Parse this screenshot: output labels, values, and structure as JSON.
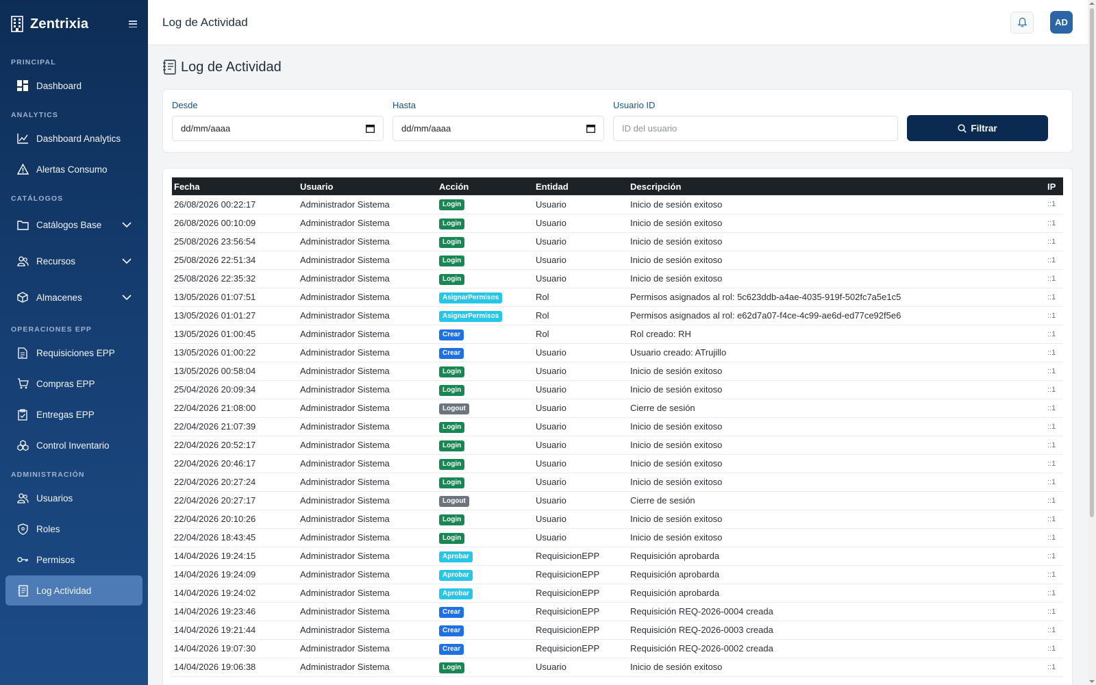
{
  "app": {
    "name": "Zentrixia"
  },
  "sidebar": {
    "sections": [
      {
        "title": "PRINCIPAL",
        "items": [
          {
            "label": "Dashboard",
            "icon": "dashboard-icon"
          }
        ]
      },
      {
        "title": "ANALYTICS",
        "items": [
          {
            "label": "Dashboard Analytics",
            "icon": "chart-line-icon"
          },
          {
            "label": "Alertas Consumo",
            "icon": "warning-icon"
          }
        ]
      },
      {
        "title": "CATÁLOGOS",
        "items": [
          {
            "label": "Catálogos Base",
            "icon": "folder-icon"
          },
          {
            "label": "Recursos",
            "icon": "people-icon"
          },
          {
            "label": "Almacenes",
            "icon": "box-icon"
          }
        ]
      },
      {
        "title": "OPERACIONES EPP",
        "items": [
          {
            "label": "Requisiciones EPP",
            "icon": "document-icon"
          },
          {
            "label": "Compras EPP",
            "icon": "cart-icon"
          },
          {
            "label": "Entregas EPP",
            "icon": "clipboard-check-icon"
          },
          {
            "label": "Control Inventario",
            "icon": "boxes-icon"
          }
        ]
      },
      {
        "title": "ADMINISTRACIÓN",
        "items": [
          {
            "label": "Usuarios",
            "icon": "people-icon"
          },
          {
            "label": "Roles",
            "icon": "shield-icon"
          },
          {
            "label": "Permisos",
            "icon": "key-icon"
          },
          {
            "label": "Log Actividad",
            "icon": "journal-icon"
          }
        ]
      }
    ]
  },
  "header": {
    "title": "Log de Actividad",
    "avatar_initials": "AD"
  },
  "page": {
    "title": "Log de Actividad"
  },
  "filters": {
    "desde_label": "Desde",
    "desde_value": "dd/mm/aaaa",
    "hasta_label": "Hasta",
    "hasta_value": "dd/mm/aaaa",
    "usuario_label": "Usuario ID",
    "usuario_placeholder": "ID del usuario",
    "button_label": "Filtrar"
  },
  "table": {
    "columns": [
      "Fecha",
      "Usuario",
      "Acción",
      "Entidad",
      "Descripción",
      "IP"
    ],
    "rows": [
      [
        "26/08/2026 00:22:17",
        "Administrador Sistema",
        "Login",
        "Usuario",
        "Inicio de sesión exitoso",
        "::1"
      ],
      [
        "26/08/2026 00:10:09",
        "Administrador Sistema",
        "Login",
        "Usuario",
        "Inicio de sesión exitoso",
        "::1"
      ],
      [
        "25/08/2026 23:56:54",
        "Administrador Sistema",
        "Login",
        "Usuario",
        "Inicio de sesión exitoso",
        "::1"
      ],
      [
        "25/08/2026 22:51:34",
        "Administrador Sistema",
        "Login",
        "Usuario",
        "Inicio de sesión exitoso",
        "::1"
      ],
      [
        "25/08/2026 22:35:32",
        "Administrador Sistema",
        "Login",
        "Usuario",
        "Inicio de sesión exitoso",
        "::1"
      ],
      [
        "13/05/2026 01:07:51",
        "Administrador Sistema",
        "AsignarPermisos",
        "Rol",
        "Permisos asignados al rol: 5c623ddb-a4ae-4035-919f-502fc7a5e1c5",
        "::1"
      ],
      [
        "13/05/2026 01:01:27",
        "Administrador Sistema",
        "AsignarPermisos",
        "Rol",
        "Permisos asignados al rol: e62d7a07-f4ce-4c99-ae6d-ed77ce92f5e6",
        "::1"
      ],
      [
        "13/05/2026 01:00:45",
        "Administrador Sistema",
        "Crear",
        "Rol",
        "Rol creado: RH",
        "::1"
      ],
      [
        "13/05/2026 01:00:22",
        "Administrador Sistema",
        "Crear",
        "Usuario",
        "Usuario creado: ATrujillo",
        "::1"
      ],
      [
        "13/05/2026 00:58:04",
        "Administrador Sistema",
        "Login",
        "Usuario",
        "Inicio de sesión exitoso",
        "::1"
      ],
      [
        "25/04/2026 20:09:34",
        "Administrador Sistema",
        "Login",
        "Usuario",
        "Inicio de sesión exitoso",
        "::1"
      ],
      [
        "22/04/2026 21:08:00",
        "Administrador Sistema",
        "Logout",
        "Usuario",
        "Cierre de sesión",
        "::1"
      ],
      [
        "22/04/2026 21:07:39",
        "Administrador Sistema",
        "Login",
        "Usuario",
        "Inicio de sesión exitoso",
        "::1"
      ],
      [
        "22/04/2026 20:52:17",
        "Administrador Sistema",
        "Login",
        "Usuario",
        "Inicio de sesión exitoso",
        "::1"
      ],
      [
        "22/04/2026 20:46:17",
        "Administrador Sistema",
        "Login",
        "Usuario",
        "Inicio de sesión exitoso",
        "::1"
      ],
      [
        "22/04/2026 20:27:24",
        "Administrador Sistema",
        "Login",
        "Usuario",
        "Inicio de sesión exitoso",
        "::1"
      ],
      [
        "22/04/2026 20:27:17",
        "Administrador Sistema",
        "Logout",
        "Usuario",
        "Cierre de sesión",
        "::1"
      ],
      [
        "22/04/2026 20:10:26",
        "Administrador Sistema",
        "Login",
        "Usuario",
        "Inicio de sesión exitoso",
        "::1"
      ],
      [
        "22/04/2026 18:43:45",
        "Administrador Sistema",
        "Login",
        "Usuario",
        "Inicio de sesión exitoso",
        "::1"
      ],
      [
        "14/04/2026 19:24:15",
        "Administrador Sistema",
        "Aprobar",
        "RequisicionEPP",
        "Requisición aprobarda",
        "::1"
      ],
      [
        "14/04/2026 19:24:09",
        "Administrador Sistema",
        "Aprobar",
        "RequisicionEPP",
        "Requisición aprobarda",
        "::1"
      ],
      [
        "14/04/2026 19:24:02",
        "Administrador Sistema",
        "Aprobar",
        "RequisicionEPP",
        "Requisición aprobarda",
        "::1"
      ],
      [
        "14/04/2026 19:23:46",
        "Administrador Sistema",
        "Crear",
        "RequisicionEPP",
        "Requisición REQ-2026-0004 creada",
        "::1"
      ],
      [
        "14/04/2026 19:21:44",
        "Administrador Sistema",
        "Crear",
        "RequisicionEPP",
        "Requisición REQ-2026-0003 creada",
        "::1"
      ],
      [
        "14/04/2026 19:07:30",
        "Administrador Sistema",
        "Crear",
        "RequisicionEPP",
        "Requisición REQ-2026-0002 creada",
        "::1"
      ],
      [
        "14/04/2026 19:06:38",
        "Administrador Sistema",
        "Login",
        "Usuario",
        "Inicio de sesión exitoso",
        "::1"
      ]
    ]
  },
  "badge_colors": {
    "Login": "#198754",
    "AsignarPermisos": "#26c6e8",
    "Crear": "#1f6fe5",
    "Logout": "#6c757d",
    "Aprobar": "#26c6e8"
  }
}
